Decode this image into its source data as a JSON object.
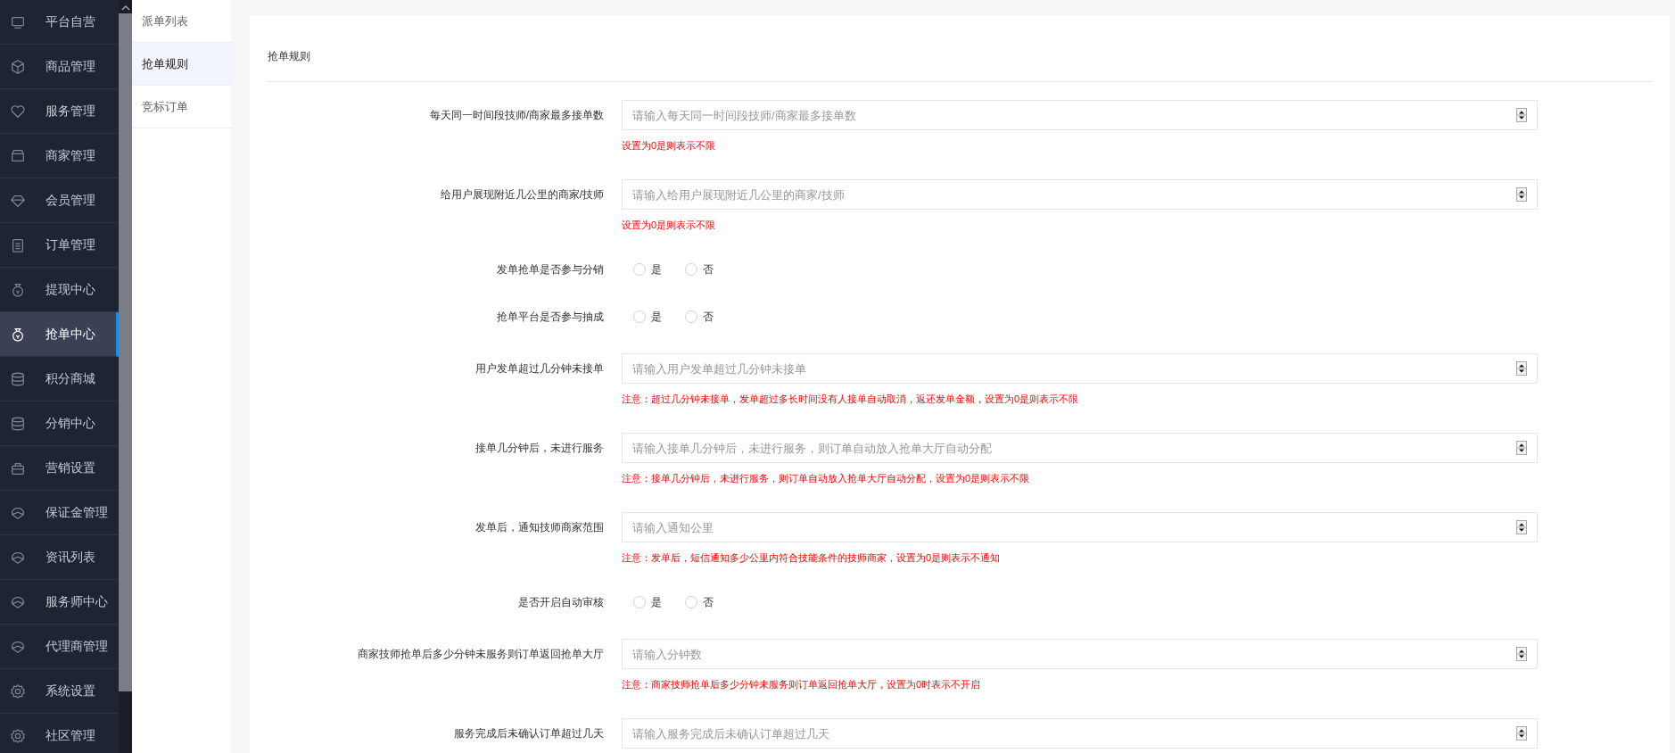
{
  "sidebar": {
    "items": [
      {
        "label": "平台自营",
        "selected": false
      },
      {
        "label": "商品管理",
        "selected": false
      },
      {
        "label": "服务管理",
        "selected": false
      },
      {
        "label": "商家管理",
        "selected": false
      },
      {
        "label": "会员管理",
        "selected": false
      },
      {
        "label": "订单管理",
        "selected": false
      },
      {
        "label": "提现中心",
        "selected": false
      },
      {
        "label": "抢单中心",
        "selected": true
      },
      {
        "label": "积分商城",
        "selected": false
      },
      {
        "label": "分销中心",
        "selected": false
      },
      {
        "label": "营销设置",
        "selected": false
      },
      {
        "label": "保证金管理",
        "selected": false
      },
      {
        "label": "资讯列表",
        "selected": false
      },
      {
        "label": "服务师中心",
        "selected": false
      },
      {
        "label": "代理商管理",
        "selected": false
      },
      {
        "label": "系统设置",
        "selected": false
      },
      {
        "label": "社区管理",
        "selected": false
      }
    ]
  },
  "submenu": {
    "items": [
      {
        "label": "派单列表",
        "selected": false
      },
      {
        "label": "抢单规则",
        "selected": true
      },
      {
        "label": "竞标订单",
        "selected": false
      }
    ]
  },
  "form": {
    "title": "抢单规则",
    "rows": [
      {
        "kind": "number",
        "label": "每天同一时间段技师/商家最多接单数",
        "placeholder": "请输入每天同一时间段技师/商家最多接单数",
        "hint": "设置为0是则表示不限"
      },
      {
        "kind": "number",
        "label": "给用户展现附近几公里的商家/技师",
        "placeholder": "请输入给用户展现附近几公里的商家/技师",
        "hint": "设置为0是则表示不限"
      },
      {
        "kind": "radio",
        "label": "发单抢单是否参与分销",
        "options": [
          {
            "label": "是",
            "selected": false
          },
          {
            "label": "否",
            "selected": false
          }
        ]
      },
      {
        "kind": "radio",
        "label": "抢单平台是否参与抽成",
        "options": [
          {
            "label": "是",
            "selected": false
          },
          {
            "label": "否",
            "selected": false
          }
        ]
      },
      {
        "kind": "number",
        "label": "用户发单超过几分钟未接单",
        "placeholder": "请输入用户发单超过几分钟未接单",
        "hint": "注意：超过几分钟未接单，发单超过多长时间没有人接单自动取消，返还发单金额，设置为0是则表示不限"
      },
      {
        "kind": "number",
        "label": "接单几分钟后，未进行服务",
        "placeholder": "请输入接单几分钟后，未进行服务，则订单自动放入抢单大厅自动分配",
        "hint": "注意：接单几分钟后，未进行服务，则订单自动放入抢单大厅自动分配，设置为0是则表示不限"
      },
      {
        "kind": "number",
        "label": "发单后，通知技师商家范围",
        "placeholder": "请输入通知公里",
        "hint": "注意：发单后，短信通知多少公里内符合技能条件的技师商家，设置为0是则表示不通知"
      },
      {
        "kind": "radio",
        "label": "是否开启自动审核",
        "options": [
          {
            "label": "是",
            "selected": false
          },
          {
            "label": "否",
            "selected": false
          }
        ]
      },
      {
        "kind": "number",
        "label": "商家技师抢单后多少分钟未服务则订单返回抢单大厅",
        "placeholder": "请输入分钟数",
        "hint": "注意：商家技师抢单后多少分钟未服务则订单返回抢单大厅，设置为0时表示不开启"
      },
      {
        "kind": "number",
        "label": "服务完成后未确认订单超过几天",
        "placeholder": "请输入服务完成后未确认订单超过几天"
      }
    ]
  }
}
